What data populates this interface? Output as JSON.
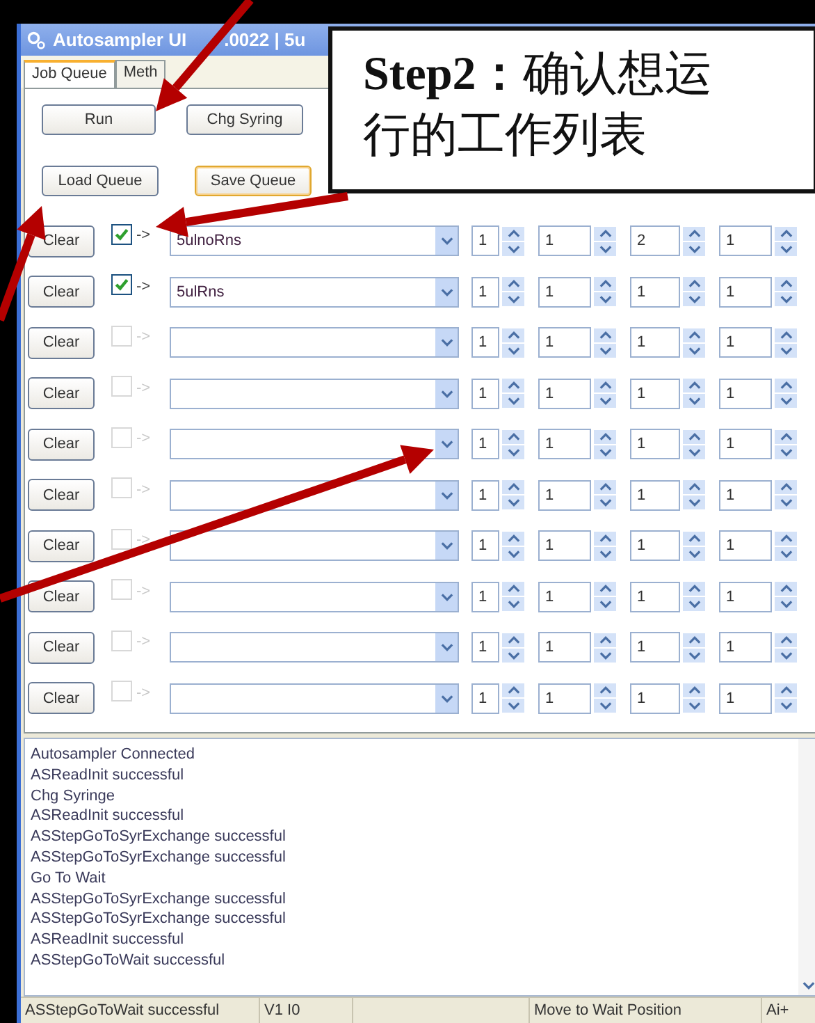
{
  "window": {
    "title": [
      "Autosampler UI",
      ".0022 | 5u"
    ]
  },
  "tabs": [
    {
      "label": "Job Queue",
      "selected": true
    },
    {
      "label": "Meth",
      "selected": false
    }
  ],
  "buttons": [
    {
      "label": "Run",
      "highlighted": false
    },
    {
      "label": "Chg Syring",
      "highlighted": false
    },
    {
      "label": "Load Queue",
      "highlighted": false
    },
    {
      "label": "Save Queue",
      "highlighted": true
    }
  ],
  "rows": [
    {
      "clear": "Clear",
      "checked": true,
      "arrow": "->",
      "program": "5ulnoRns",
      "values": [
        "1",
        "1",
        "2",
        "1"
      ]
    },
    {
      "clear": "Clear",
      "checked": true,
      "arrow": "->",
      "program": "5ulRns",
      "values": [
        "1",
        "1",
        "1",
        "1"
      ]
    },
    {
      "clear": "Clear",
      "checked": false,
      "arrow": "->",
      "values": [
        "1",
        "1",
        "1",
        "1"
      ]
    },
    {
      "clear": "Clear",
      "checked": false,
      "arrow": "->",
      "values": [
        "1",
        "1",
        "1",
        "1"
      ]
    },
    {
      "clear": "Clear",
      "checked": false,
      "arrow": "->",
      "values": [
        "1",
        "1",
        "1",
        "1"
      ]
    },
    {
      "clear": "Clear",
      "checked": false,
      "arrow": "->",
      "values": [
        "1",
        "1",
        "1",
        "1"
      ]
    },
    {
      "clear": "Clear",
      "checked": false,
      "arrow": "->",
      "values": [
        "1",
        "1",
        "1",
        "1"
      ]
    },
    {
      "clear": "Clear",
      "checked": false,
      "arrow": "->",
      "values": [
        "1",
        "1",
        "1",
        "1"
      ]
    },
    {
      "clear": "Clear",
      "checked": false,
      "arrow": "->",
      "values": [
        "1",
        "1",
        "1",
        "1"
      ]
    },
    {
      "clear": "Clear",
      "checked": false,
      "arrow": "->",
      "values": [
        "1",
        "1",
        "1",
        "1"
      ]
    }
  ],
  "log": [
    "Autosampler Connected",
    "ASReadInit successful",
    "Chg Syringe",
    "ASReadInit successful",
    "ASStepGoToSyrExchange successful",
    "ASStepGoToSyrExchange successful",
    "Go To Wait",
    "ASStepGoToSyrExchange successful",
    "ASStepGoToSyrExchange successful",
    "ASReadInit successful",
    "ASStepGoToWait successful"
  ],
  "status_bar": [
    {
      "kind": "text",
      "text": "ASStepGoToWait successful"
    },
    {
      "kind": "text",
      "text": "V1 I0"
    },
    {
      "kind": "spacer"
    },
    {
      "kind": "text",
      "text": "Move to Wait Position"
    },
    {
      "kind": "text",
      "text": "Ai+"
    }
  ],
  "callout": {
    "lines": [
      "**Step2：**确认想运",
      "行的工作列表"
    ]
  }
}
